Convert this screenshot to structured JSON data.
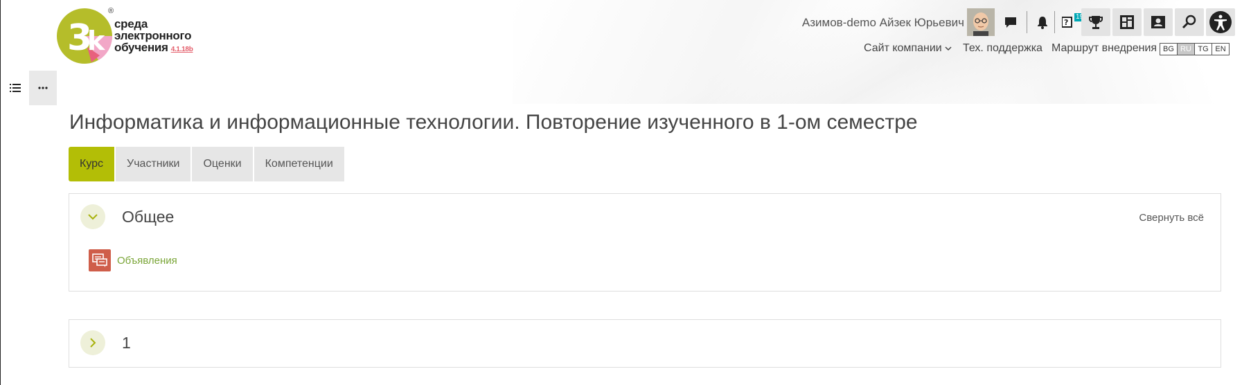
{
  "logo": {
    "mark": "3k",
    "line1": "среда",
    "line2": "электронного",
    "line3": "обучения",
    "version": "4.1.18b",
    "registered": "®"
  },
  "header": {
    "user_name": "Азимов-demo Айзек Юрьевич",
    "icons": [
      "chat-icon",
      "bell-icon",
      "help-icon",
      "trophy-icon",
      "dashboard-icon",
      "profile-card-icon",
      "search-icon",
      "accessibility-icon"
    ],
    "help_badge": "19"
  },
  "nav": {
    "company_site": "Сайт компании",
    "support": "Тех. поддержка",
    "roadmap": "Маршрут внедрения"
  },
  "languages": [
    {
      "code": "BG",
      "active": false
    },
    {
      "code": "RU",
      "active": true
    },
    {
      "code": "TG",
      "active": false
    },
    {
      "code": "EN",
      "active": false
    }
  ],
  "page": {
    "title": "Информатика и информационные технологии. Повторение изученного в 1-ом семестре"
  },
  "tabs": [
    {
      "label": "Курс",
      "active": true
    },
    {
      "label": "Участники",
      "active": false
    },
    {
      "label": "Оценки",
      "active": false
    },
    {
      "label": "Компетенции",
      "active": false
    }
  ],
  "sections": [
    {
      "title": "Общее",
      "expanded": true,
      "collapse_all": "Свернуть всё",
      "activities": [
        {
          "label": "Объявления",
          "icon": "forum-icon"
        }
      ]
    },
    {
      "title": "1",
      "expanded": false
    }
  ],
  "colors": {
    "accent": "#b3be06",
    "activity_icon": "#cf5e4a",
    "link": "#7aa537"
  }
}
